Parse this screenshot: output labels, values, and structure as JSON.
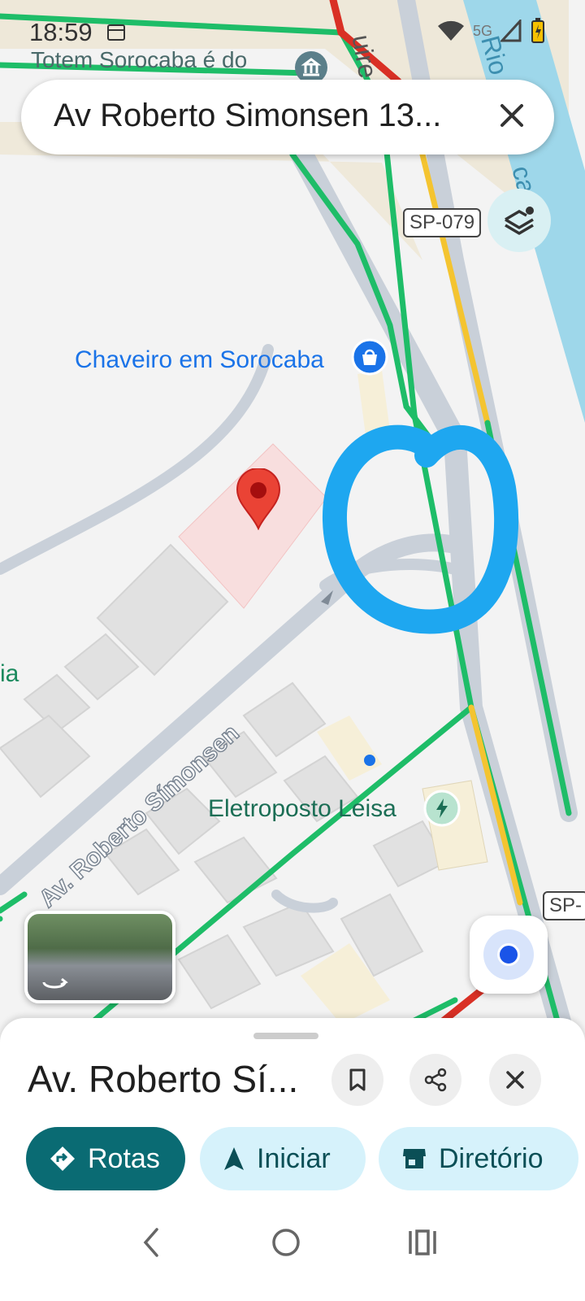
{
  "status_bar": {
    "time": "18:59",
    "network": "5G"
  },
  "search": {
    "query": "Av Roberto Simonsen 13..."
  },
  "map": {
    "top_poi": "Totem Sorocaba é do",
    "road_shield_1": "SP-079",
    "road_shield_2": "SP-",
    "river_label": "Rio",
    "river_label_2": "car",
    "road_label_top": "uire",
    "poi_chaveiro": "Chaveiro em Sorocaba",
    "poi_left_partial": "ia",
    "street_label": "Av. Roberto Símonsen",
    "poi_eletroposto": "Eletroposto Leisa"
  },
  "sheet": {
    "title": "Av. Roberto Sí...",
    "chips": {
      "routes": "Rotas",
      "start": "Iniciar",
      "directory": "Diretório"
    }
  },
  "colors": {
    "traffic_green": "#1ebd68",
    "traffic_yellow": "#f4c430",
    "traffic_red": "#d93025",
    "annotation_blue": "#1ea7f0",
    "pin_red": "#ea4335",
    "primary_chip": "#0a6b73"
  }
}
